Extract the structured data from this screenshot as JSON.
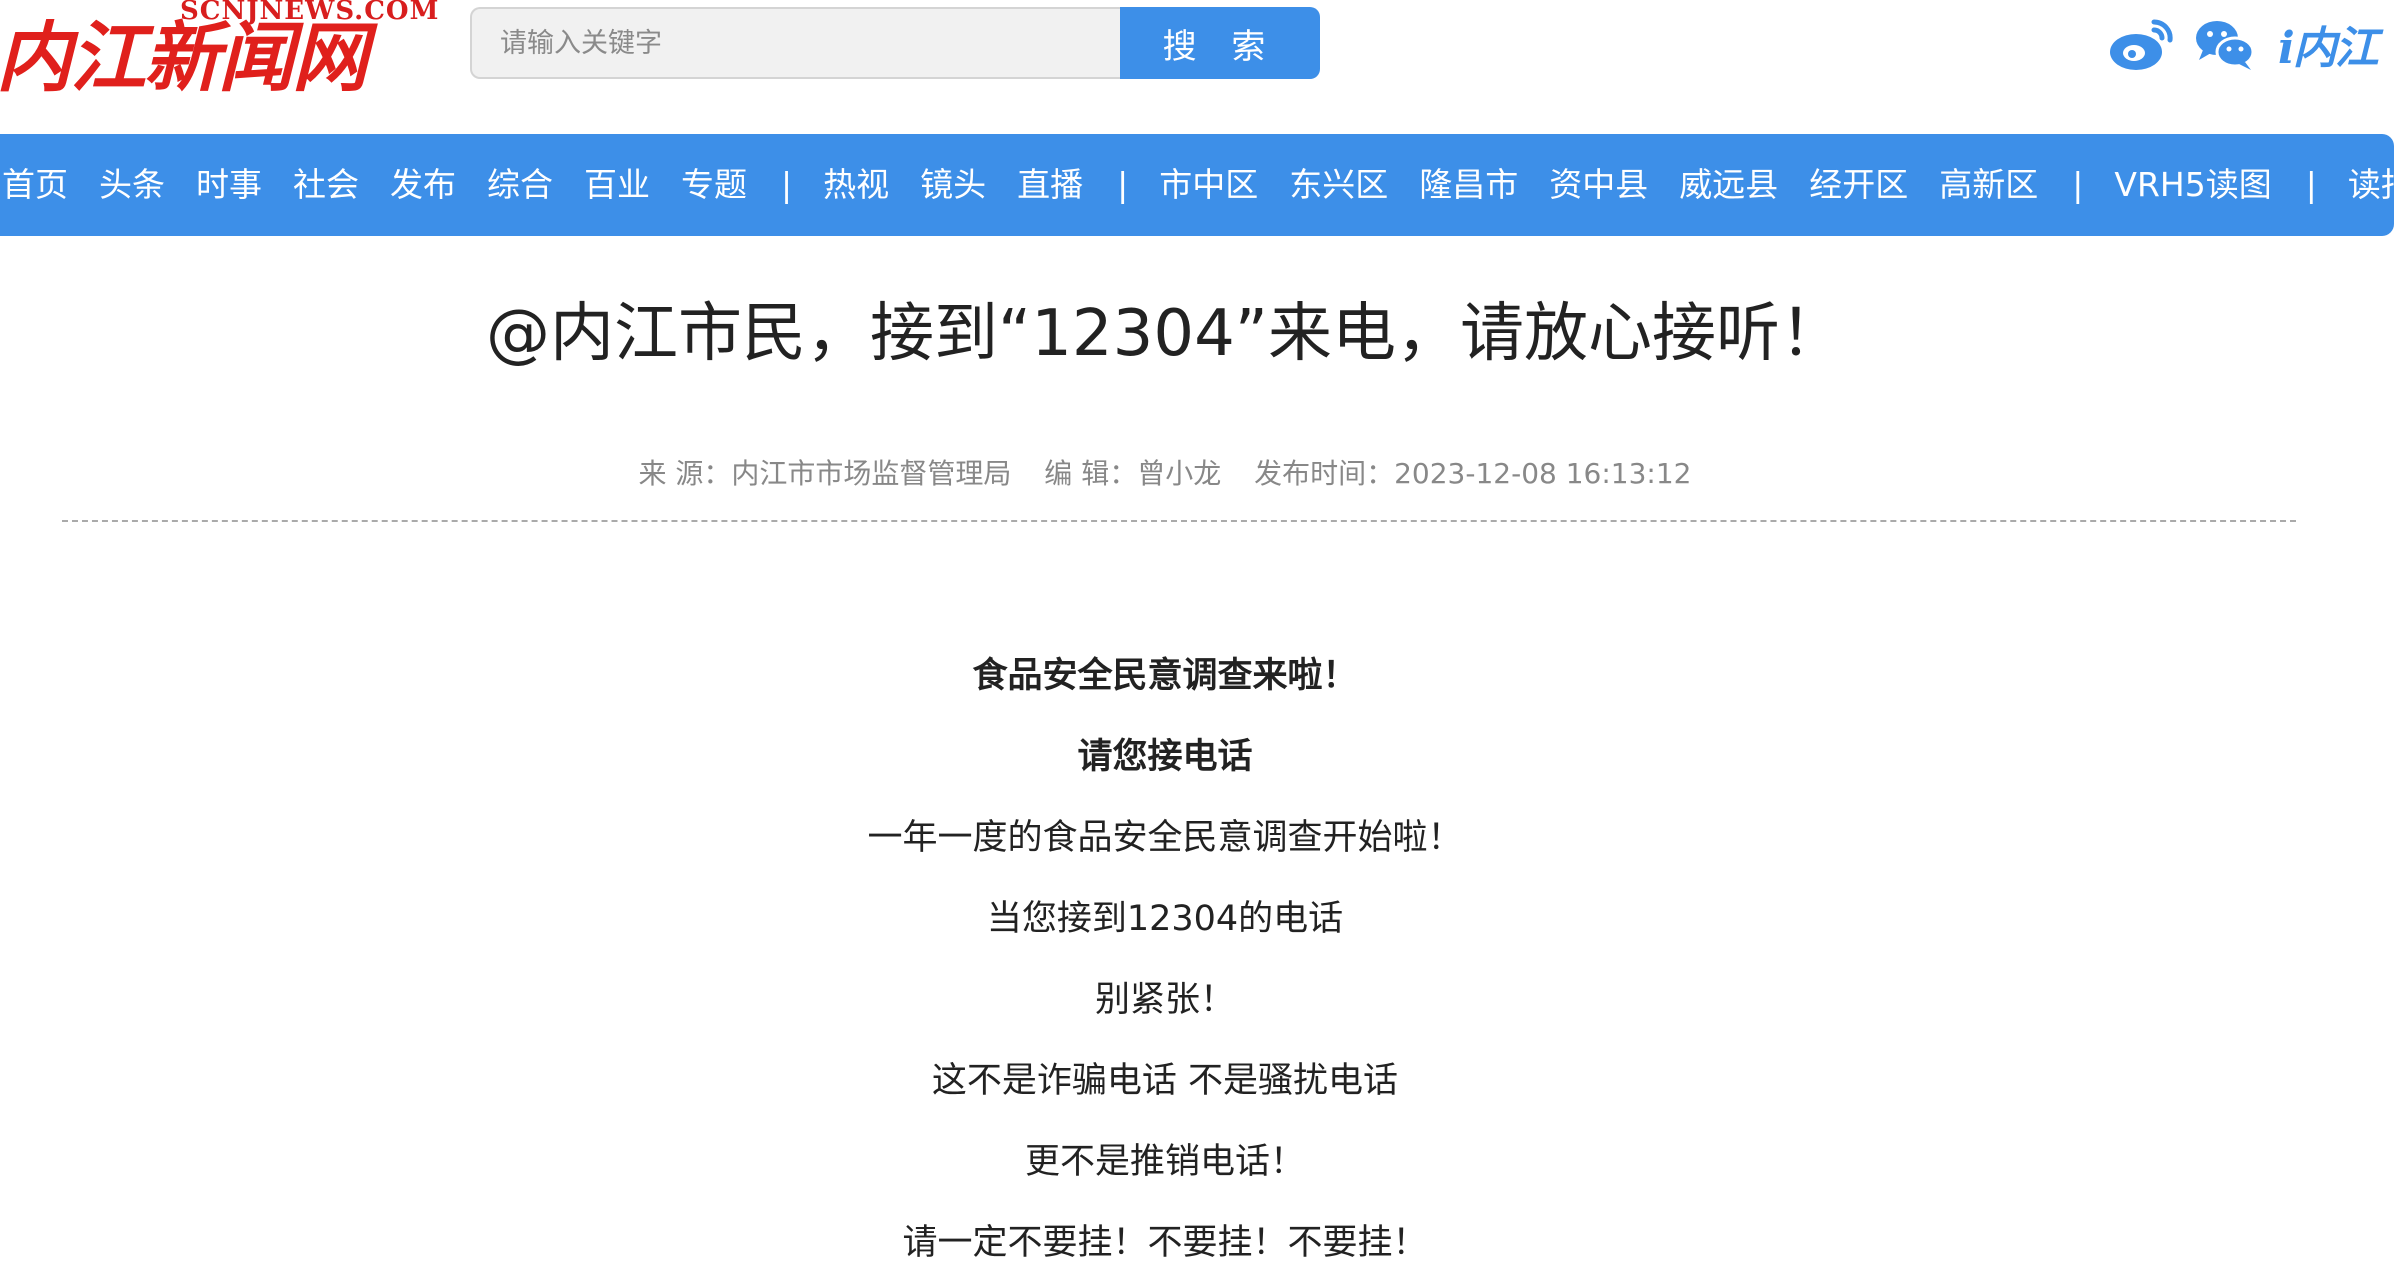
{
  "logo": {
    "main": "内江新闻网",
    "sub": "SCNJNEWS.COM"
  },
  "search": {
    "placeholder": "请输入关键字",
    "button": "搜 索"
  },
  "social": {
    "brand_text": "i内江",
    "colors": {
      "accent": "#3d8fe8",
      "logo_red": "#e0201c"
    }
  },
  "nav": {
    "items": [
      "首页",
      "头条",
      "时事",
      "社会",
      "发布",
      "综合",
      "百业",
      "专题",
      "|",
      "热视",
      "镜头",
      "直播",
      "|",
      "市中区",
      "东兴区",
      "隆昌市",
      "资中县",
      "威远县",
      "经开区",
      "高新区",
      "|",
      "VRH5读图",
      "|",
      "读报"
    ]
  },
  "article": {
    "title": "@内江市民，接到“12304”来电，请放心接听！",
    "source": "来 源：内江市市场监督管理局",
    "editor": "编 辑：曾小龙",
    "publish_time": "发布时间：2023-12-08 16:13:12",
    "paragraphs": [
      {
        "text": "食品安全民意调查来啦！",
        "bold": true
      },
      {
        "text": "请您接电话",
        "bold": true
      },
      {
        "text": "一年一度的食品安全民意调查开始啦！",
        "bold": false
      },
      {
        "text": "当您接到12304的电话",
        "bold": false
      },
      {
        "text": "别紧张！",
        "bold": false
      },
      {
        "text": "这不是诈骗电话 不是骚扰电话",
        "bold": false
      },
      {
        "text": "更不是推销电话！",
        "bold": false
      },
      {
        "text": "请一定不要挂！不要挂！不要挂！",
        "bold": false
      }
    ]
  }
}
